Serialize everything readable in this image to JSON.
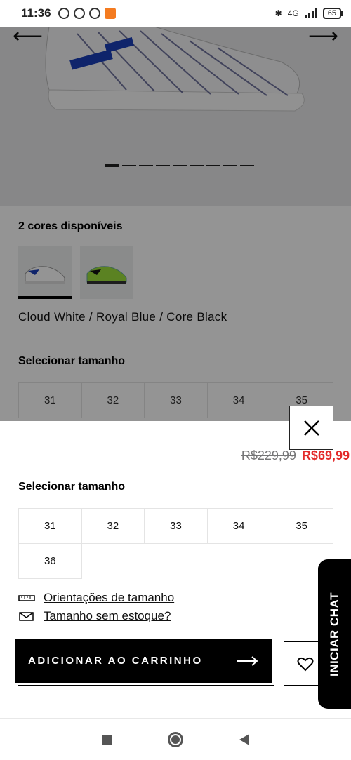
{
  "status_bar": {
    "time": "11:36",
    "network": "4G",
    "battery": "65"
  },
  "product": {
    "colors_title": "2 cores disponíveis",
    "selected_color_name": "Cloud White / Royal Blue / Core Black",
    "size_title": "Selecionar tamanho",
    "image_dots_count": 9,
    "image_dots_active_index": 0
  },
  "background_sizes": [
    "31",
    "32",
    "33",
    "34",
    "35"
  ],
  "sheet": {
    "price_old": "R$229,99",
    "price_new": "R$69,99",
    "size_title": "Selecionar tamanho",
    "sizes": [
      "31",
      "32",
      "33",
      "34",
      "35",
      "36"
    ],
    "size_guide_link": "Orientações de tamanho",
    "out_of_stock_link": "Tamanho sem estoque?",
    "add_to_cart_label": "ADICIONAR AO CARRINHO"
  },
  "chat": {
    "label": "INICIAR CHAT"
  },
  "colors": {
    "sale_price": "#e32b2b",
    "old_price": "#767677",
    "primary_button": "#000000",
    "overlay": "rgba(0,0,0,0.42)"
  }
}
